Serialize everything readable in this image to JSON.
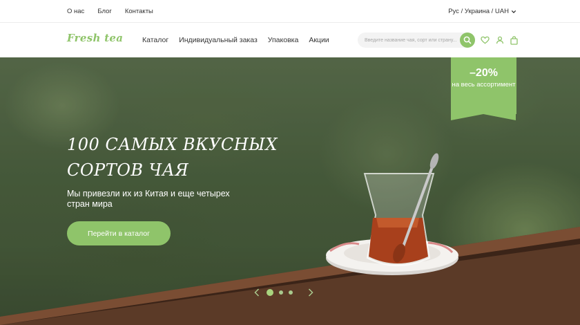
{
  "topbar": {
    "links": [
      "О нас",
      "Блог",
      "Контакты"
    ],
    "locale": "Рус / Украина / UAH"
  },
  "header": {
    "logo": "Fresh tea",
    "nav": [
      "Каталог",
      "Индивидуальный заказ",
      "Упаковка",
      "Акции"
    ],
    "search_placeholder": "Введите название чая, сорт или страну...",
    "icons": [
      "search-icon",
      "heart-icon",
      "user-icon",
      "bag-icon"
    ]
  },
  "hero": {
    "discount_value": "–20%",
    "discount_text": "на весь ассортимент",
    "title_line1": "100 самых вкусных",
    "title_line2": "сортов чая",
    "subtitle": "Мы привезли их из Китая и еще четырех стран мира",
    "cta": "Перейти в каталог",
    "slides_total": 3,
    "slide_active": 1
  },
  "colors": {
    "accent": "#8fc46a",
    "text": "#333333"
  }
}
